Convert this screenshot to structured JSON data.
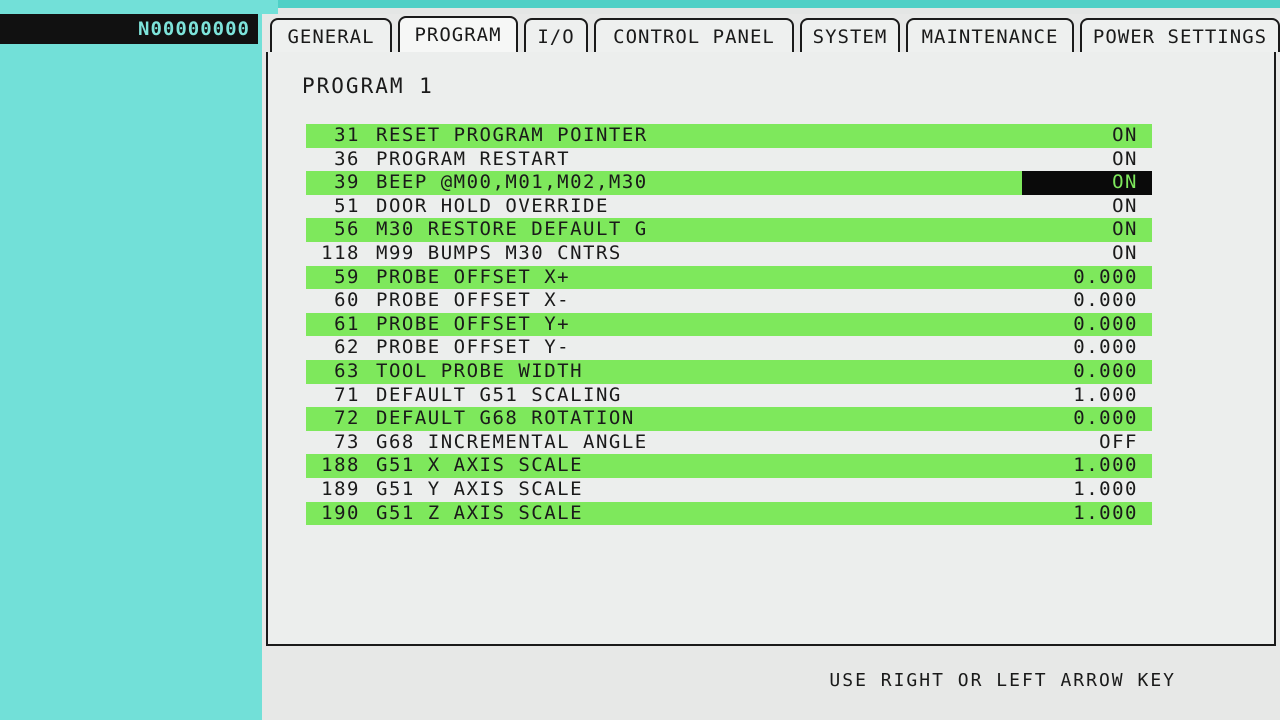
{
  "header": {
    "program_number": "N00000000"
  },
  "tabs": [
    {
      "label": "GENERAL",
      "active": false
    },
    {
      "label": "PROGRAM",
      "active": true
    },
    {
      "label": "I/O",
      "active": false
    },
    {
      "label": "CONTROL PANEL",
      "active": false
    },
    {
      "label": "SYSTEM",
      "active": false
    },
    {
      "label": "MAINTENANCE",
      "active": false
    },
    {
      "label": "POWER SETTINGS",
      "active": false
    }
  ],
  "section": {
    "title": "PROGRAM 1"
  },
  "settings": [
    {
      "num": "31",
      "desc": "RESET PROGRAM POINTER",
      "value": "ON",
      "highlight": true
    },
    {
      "num": "36",
      "desc": "PROGRAM RESTART",
      "value": "ON",
      "highlight": false
    },
    {
      "num": "39",
      "desc": "BEEP @M00,M01,M02,M30",
      "value": "ON",
      "highlight": true,
      "selected": true
    },
    {
      "num": "51",
      "desc": "DOOR HOLD OVERRIDE",
      "value": "ON",
      "highlight": false
    },
    {
      "num": "56",
      "desc": "M30 RESTORE DEFAULT G",
      "value": "ON",
      "highlight": true
    },
    {
      "num": "118",
      "desc": "M99 BUMPS M30 CNTRS",
      "value": "ON",
      "highlight": false
    },
    {
      "num": "59",
      "desc": "PROBE OFFSET X+",
      "value": "0.000",
      "highlight": true
    },
    {
      "num": "60",
      "desc": "PROBE OFFSET X-",
      "value": "0.000",
      "highlight": false
    },
    {
      "num": "61",
      "desc": "PROBE OFFSET Y+",
      "value": "0.000",
      "highlight": true
    },
    {
      "num": "62",
      "desc": "PROBE OFFSET Y-",
      "value": "0.000",
      "highlight": false
    },
    {
      "num": "63",
      "desc": "TOOL PROBE WIDTH",
      "value": "0.000",
      "highlight": true
    },
    {
      "num": "71",
      "desc": "DEFAULT G51 SCALING",
      "value": "1.000",
      "highlight": false
    },
    {
      "num": "72",
      "desc": "DEFAULT G68 ROTATION",
      "value": "0.000",
      "highlight": true
    },
    {
      "num": "73",
      "desc": "G68 INCREMENTAL ANGLE",
      "value": "OFF",
      "highlight": false
    },
    {
      "num": "188",
      "desc": "G51 X AXIS SCALE",
      "value": "1.000",
      "highlight": true
    },
    {
      "num": "189",
      "desc": "G51 Y AXIS SCALE",
      "value": "1.000",
      "highlight": false
    },
    {
      "num": "190",
      "desc": "G51 Z AXIS SCALE",
      "value": "1.000",
      "highlight": true
    }
  ],
  "footer": {
    "help": "USE RIGHT OR LEFT ARROW KEY"
  },
  "colors": {
    "highlight": "#7ee85c",
    "left_panel": "#72e0d8",
    "selected_bg": "#0a0a0a"
  }
}
